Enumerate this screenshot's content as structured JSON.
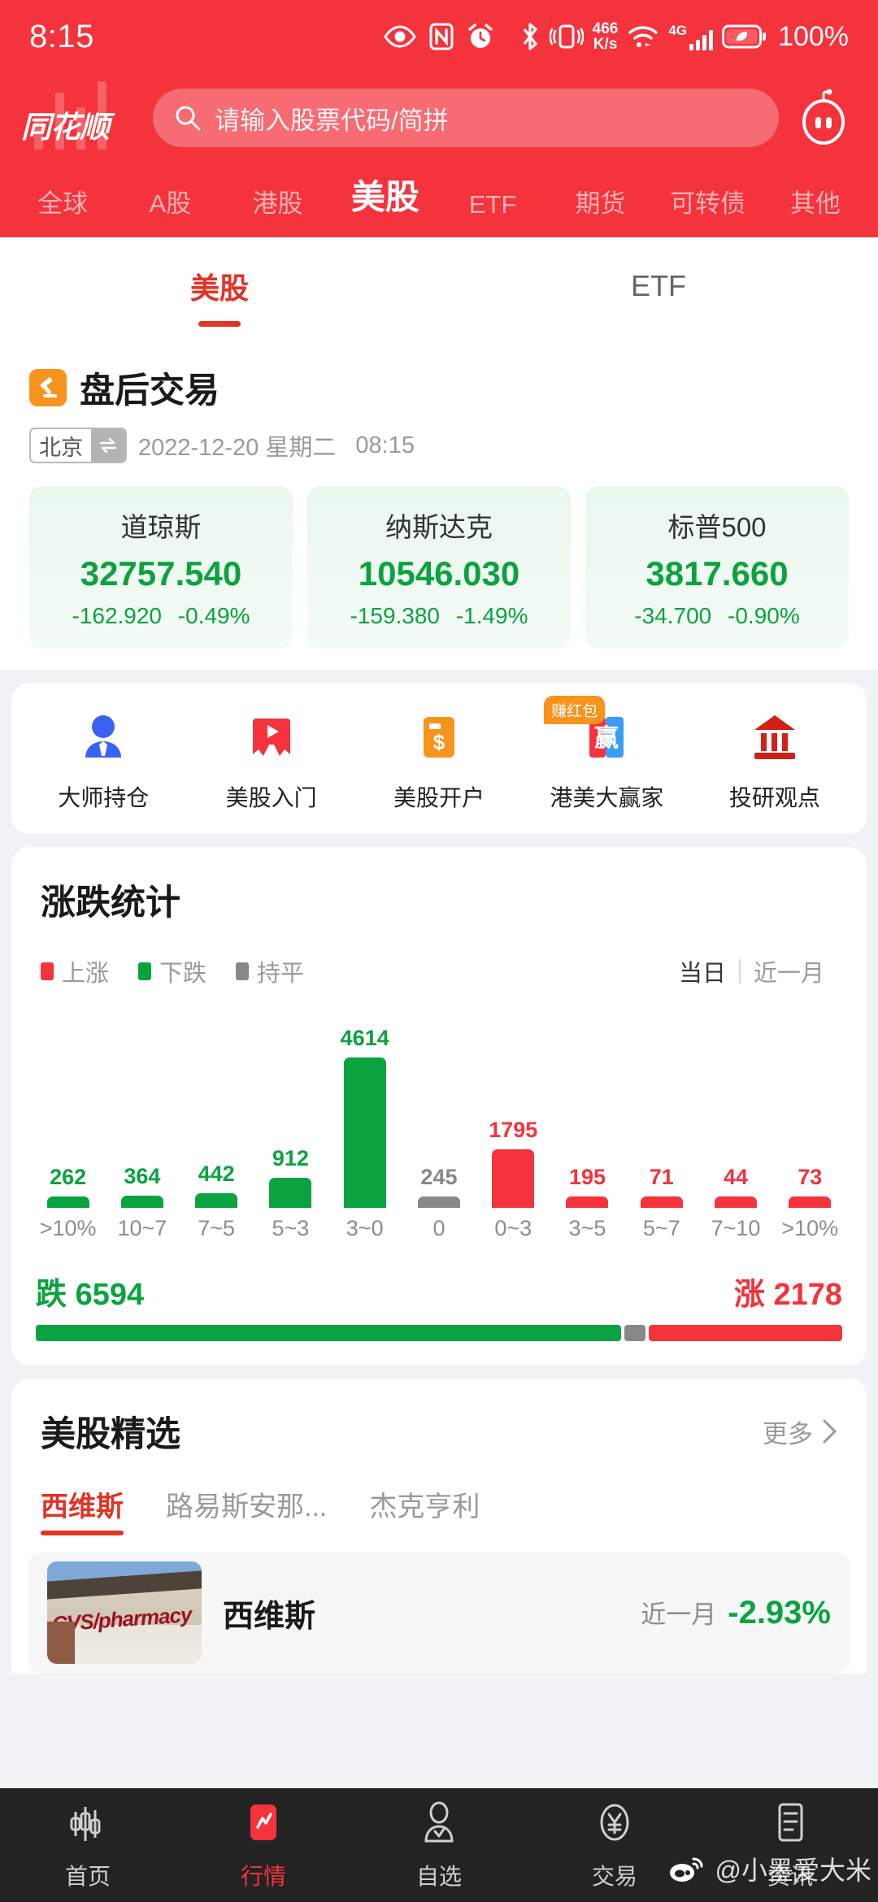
{
  "status_bar": {
    "time": "8:15",
    "net_speed_value": "466",
    "net_speed_unit": "K/s",
    "network_type": "4G",
    "battery": "100%",
    "icons": [
      "eye-icon",
      "nfc-icon",
      "alarm-icon",
      "bluetooth-icon",
      "vibrate-icon",
      "wifi-icon",
      "signal-icon",
      "battery-icon"
    ]
  },
  "header": {
    "logo_text": "同花顺",
    "search_placeholder": "请输入股票代码/简拼",
    "search_value": "",
    "assistant_icon": "robot-icon"
  },
  "top_nav": {
    "items": [
      {
        "label": "全球",
        "active": false
      },
      {
        "label": "A股",
        "active": false
      },
      {
        "label": "港股",
        "active": false
      },
      {
        "label": "美股",
        "active": true
      },
      {
        "label": "ETF",
        "active": false
      },
      {
        "label": "期货",
        "active": false
      },
      {
        "label": "可转债",
        "active": false
      },
      {
        "label": "其他",
        "active": false
      }
    ]
  },
  "sub_tabs": [
    {
      "label": "美股",
      "active": true
    },
    {
      "label": "ETF",
      "active": false
    }
  ],
  "after_hours": {
    "title": "盘后交易",
    "title_icon": "gavel-icon",
    "city": "北京",
    "switch_icon": "swap-icon",
    "date": "2022-12-20 星期二",
    "time": "08:15",
    "indices": [
      {
        "name": "道琼斯",
        "value": "32757.540",
        "change": "-162.920",
        "change_pct": "-0.49%",
        "direction": "down"
      },
      {
        "name": "纳斯达克",
        "value": "10546.030",
        "change": "-159.380",
        "change_pct": "-1.49%",
        "direction": "down"
      },
      {
        "name": "标普500",
        "value": "3817.660",
        "change": "-34.700",
        "change_pct": "-0.90%",
        "direction": "down"
      }
    ]
  },
  "shortcuts": [
    {
      "label": "大师持仓",
      "icon": "investor-person-icon",
      "badge": ""
    },
    {
      "label": "美股入门",
      "icon": "video-bookmark-icon",
      "badge": ""
    },
    {
      "label": "美股开户",
      "icon": "dollar-card-icon",
      "badge": ""
    },
    {
      "label": "港美大赢家",
      "icon": "win-banner-icon",
      "badge": "赚红包"
    },
    {
      "label": "投研观点",
      "icon": "bank-icon",
      "badge": ""
    }
  ],
  "stats": {
    "title": "涨跌统计",
    "legend": [
      {
        "label": "上涨",
        "color": "#f4333c"
      },
      {
        "label": "下跌",
        "color": "#0aa33f"
      },
      {
        "label": "持平",
        "color": "#888888"
      }
    ],
    "ranges": [
      {
        "label": "当日",
        "active": true
      },
      {
        "label": "近一月",
        "active": false
      }
    ],
    "summary": {
      "down_label": "跌",
      "down_count": "6594",
      "up_label": "涨",
      "up_count": "2178",
      "flat_count": "245"
    }
  },
  "chart_data": {
    "type": "bar",
    "title": "涨跌统计",
    "xlabel": "",
    "ylabel": "",
    "categories": [
      ">10%",
      "10~7",
      "7~5",
      "5~3",
      "3~0",
      "0",
      "0~3",
      "3~5",
      "5~7",
      "7~10",
      ">10%"
    ],
    "values": [
      262,
      364,
      442,
      912,
      4614,
      245,
      1795,
      195,
      71,
      44,
      73
    ],
    "colors": [
      "#0aa33f",
      "#0aa33f",
      "#0aa33f",
      "#0aa33f",
      "#0aa33f",
      "#888888",
      "#f4333c",
      "#f4333c",
      "#f4333c",
      "#f4333c",
      "#f4333c"
    ],
    "series": [
      {
        "name": "下跌",
        "categories": [
          ">10%",
          "10~7",
          "7~5",
          "5~3",
          "3~0"
        ],
        "values": [
          262,
          364,
          442,
          912,
          4614
        ]
      },
      {
        "name": "持平",
        "categories": [
          "0"
        ],
        "values": [
          245
        ]
      },
      {
        "name": "上涨",
        "categories": [
          "0~3",
          "3~5",
          "5~7",
          "7~10",
          ">10%"
        ],
        "values": [
          1795,
          195,
          71,
          44,
          73
        ]
      }
    ],
    "ylim": [
      0,
      4614
    ],
    "grid": false,
    "legend_position": "top-left",
    "totals": {
      "下跌": 6594,
      "持平": 245,
      "上涨": 2178
    }
  },
  "picks": {
    "title": "美股精选",
    "more_label": "更多",
    "more_icon": "chevron-right-icon",
    "tabs": [
      {
        "label": "西维斯",
        "active": true
      },
      {
        "label": "路易斯安那...",
        "active": false
      },
      {
        "label": "杰克亨利",
        "active": false
      }
    ],
    "card": {
      "name": "西维斯",
      "period": "近一月",
      "change_pct": "-2.93%",
      "direction": "down",
      "thumb_text": "CVS/pharmacy"
    }
  },
  "bottom_nav": [
    {
      "label": "首页",
      "icon": "candlestick-icon",
      "active": false
    },
    {
      "label": "行情",
      "icon": "quote-chart-icon",
      "active": true
    },
    {
      "label": "自选",
      "icon": "person-check-icon",
      "active": false
    },
    {
      "label": "交易",
      "icon": "yuan-circle-icon",
      "active": false
    },
    {
      "label": "资讯",
      "icon": "news-list-icon",
      "active": false
    }
  ],
  "watermark": {
    "icon": "weibo-icon",
    "text": "@小墨爱大米"
  },
  "colors": {
    "brand_red": "#f4333c",
    "up_red": "#f4333c",
    "down_green": "#0aa33f",
    "flat_gray": "#888888",
    "accent_orange": "#f7941d"
  }
}
